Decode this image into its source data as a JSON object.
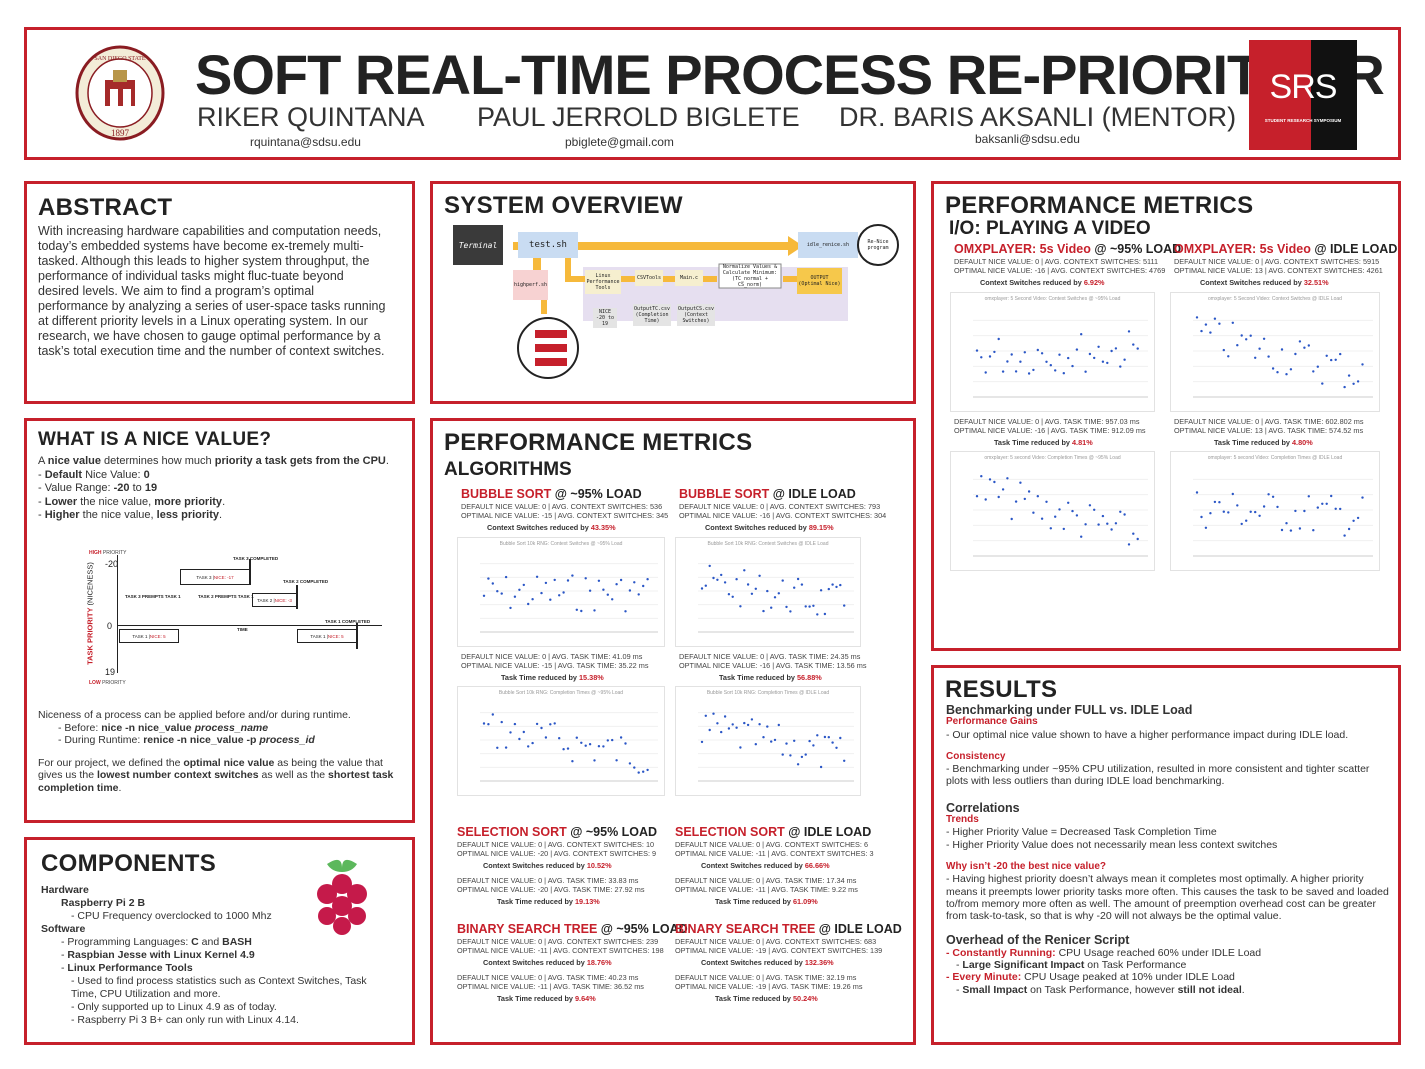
{
  "header": {
    "title": "SOFT REAL-TIME PROCESS RE-PRIORITIZER",
    "authors": [
      {
        "name": "RIKER QUINTANA",
        "email": "rquintana@sdsu.edu"
      },
      {
        "name": "PAUL JERROLD BIGLETE",
        "email": "pbiglete@gmail.com"
      },
      {
        "name": "DR. BARIS AKSANLI (MENTOR)",
        "email": "baksanli@sdsu.edu"
      }
    ],
    "seal_text": "SAN DIEGO STATE UNIVERSITY",
    "seal_year": "1897",
    "srs_logo": "SRS",
    "srs_sub": "STUDENT RESEARCH SYMPOSIUM"
  },
  "abstract": {
    "heading": "ABSTRACT",
    "body": "With increasing hardware capabilities and computation needs, today’s embedded systems have become ex-tremely multi-tasked. Although this leads to higher system throughput, the performance of individual tasks might fluc-tuate beyond desired levels. We aim to find a program’s optimal performance by analyzing a series of user-space tasks running at different priority levels in a Linux operating system. In our research, we have chosen to gauge optimal performance by a task’s total execution time and the number of context switches."
  },
  "nice": {
    "heading": "WHAT IS A NICE VALUE?",
    "l1a": "A ",
    "l1b": "nice value",
    "l1c": " determines how much ",
    "l1d": "priority a task gets from the CPU",
    "l1e": ".",
    "l2a": "- ",
    "l2b": "Default",
    "l2c": " Nice Value: ",
    "l2d": "0",
    "l3a": "- Value Range: ",
    "l3b": "-20",
    "l3c": " to ",
    "l3d": "19",
    "l4a": "- ",
    "l4b": "Lower",
    "l4c": " the nice value, ",
    "l4d": "more priority",
    "l4e": ".",
    "l5a": "- ",
    "l5b": "Higher",
    "l5c": " the nice value, ",
    "l5d": "less priority",
    "l5e": ".",
    "diagram": {
      "high": "HIGH",
      "high2": "PRIORITY",
      "low": "LOW",
      "low2": "PRIORITY",
      "axis": "TASK PRIORITY",
      "axis2": "(NICENESS)",
      "y_top": "-20",
      "y_mid": "0",
      "y_bot": "19",
      "time": "TIME",
      "t3a": "TASK 3 | ",
      "t3b": "NICE: -17",
      "t3done": "TASK 3 COMPLETED",
      "t2a": "TASK 2 | ",
      "t2b": "NICE: -3",
      "t2done": "TASK 2 COMPLETED",
      "t1a": "TASK 1 | ",
      "t1b": "NICE: 5",
      "t1done": "TASK 1 COMPLETED",
      "p31": "TASK 3 PREMPTS TASK 1",
      "p21": "TASK 2 PREMPTS TASK 1"
    },
    "r1": "Niceness of a process can be applied before and/or during runtime.",
    "r2a": "- Before: ",
    "r2b": "nice -n nice_value ",
    "r2c": "process_name",
    "r3a": "- During Runtime: ",
    "r3b": "renice -n nice_value -p ",
    "r3c": "process_id",
    "r4a": "For our project, we defined the ",
    "r4b": "optimal nice value",
    "r4c": " as being the value that gives us the ",
    "r4d": "lowest number context switches",
    "r4e": " as well as the ",
    "r4f": "shortest task completion time",
    "r4g": "."
  },
  "components": {
    "heading": "COMPONENTS",
    "hw": "Hardware",
    "pi": "Raspberry Pi 2 B",
    "cpu": "- CPU Frequency overclocked to 1000 Mhz",
    "sw": "Software",
    "lang_a": "- Programming Languages: ",
    "lang_b": "C",
    "lang_c": " and ",
    "lang_d": "BASH",
    "os_a": "- ",
    "os_b": "Raspbian Jesse with  Linux Kernel 4.9",
    "lpt_a": "- ",
    "lpt_b": "Linux Performance Tools",
    "lpt1": "- Used to find process statistics such as Context Switches, Task Time, CPU Utilization and more.",
    "lpt2": "- Only supported up to Linux 4.9 as of today.",
    "lpt3": "- Raspberry Pi 3 B+ can only run with Linux 4.14."
  },
  "overview": {
    "heading": "SYSTEM OVERVIEW",
    "terminal": "Terminal",
    "test": "test.sh",
    "idle": "idle_renice.sh",
    "renice": "Re-Nice program",
    "highperf": "highperf.sh",
    "lpt": "Linux Performance Tools",
    "csv": "CSVTools",
    "main": "Main.c",
    "norm": "Normalize Values & Calculate Minimum:(TC_normal + CS_norm)",
    "output": "OUTPUT (Optimal Nice)",
    "nice": "NICE -20 to 19",
    "out1": "OutputTC.csv (Completion Time)",
    "out2": "OutputCS.csv (Context Switches)"
  },
  "algorithms": {
    "heading": "PERFORMANCE METRICS",
    "sub": "ALGORITHMS",
    "items": [
      {
        "name": "BUBBLE SORT",
        "load": " @ ~95% LOAD",
        "cs1": "DEFAULT NICE VALUE: 0 | AVG. CONTEXT SWITCHES: 536",
        "cs2": "OPTIMAL NICE VALUE: -15 | AVG. CONTEXT SWITCHES: 345",
        "csr_label": "Context Switches reduced by ",
        "csr": "43.35%",
        "tt1": "DEFAULT NICE VALUE: 0 | AVG. TASK TIME: 41.09 ms",
        "tt2": "OPTIMAL NICE VALUE: -15 | AVG. TASK TIME: 35.22 ms",
        "ttr_label": "Task Time reduced by ",
        "ttr": "15.38%",
        "chart1": "Bubble Sort 10k RNG: Context Switches @ ~95% Load",
        "chart2": "Bubble Sort 10k RNG: Completion Times @ ~95% Load"
      },
      {
        "name": "BUBBLE SORT",
        "load": " @ IDLE LOAD",
        "cs1": "DEFAULT NICE VALUE: 0 | AVG. CONTEXT SWITCHES: 793",
        "cs2": "OPTIMAL NICE VALUE: -16 | AVG. CONTEXT SWITCHES: 304",
        "csr_label": "Context Switches reduced by ",
        "csr": "89.15%",
        "tt1": "DEFAULT NICE VALUE: 0 | AVG. TASK TIME: 24.35 ms",
        "tt2": "OPTIMAL NICE VALUE: -16 | AVG. TASK TIME: 13.56 ms",
        "ttr_label": "Task Time reduced by ",
        "ttr": "56.88%",
        "chart1": "Bubble Sort 10k RNG: Context Switches @ IDLE Load",
        "chart2": "Bubble Sort 10k RNG: Completion Times @ IDLE Load"
      },
      {
        "name": "SELECTION SORT",
        "load": " @ ~95% LOAD",
        "cs1": "DEFAULT NICE VALUE: 0 | AVG. CONTEXT SWITCHES: 10",
        "cs2": "OPTIMAL NICE VALUE: -20 | AVG. CONTEXT SWITCHES: 9",
        "csr_label": "Context Switches reduced by ",
        "csr": "10.52%",
        "tt1": "DEFAULT NICE VALUE: 0 | AVG. TASK TIME: 33.83 ms",
        "tt2": "OPTIMAL NICE VALUE: -20 | AVG. TASK TIME: 27.92 ms",
        "ttr_label": "Task Time reduced by ",
        "ttr": "19.13%"
      },
      {
        "name": "SELECTION SORT",
        "load": " @ IDLE LOAD",
        "cs1": "DEFAULT NICE VALUE: 0 | AVG. CONTEXT SWITCHES: 6",
        "cs2": "OPTIMAL NICE VALUE: -11 | AVG. CONTEXT SWITCHES: 3",
        "csr_label": "Context Switches reduced by ",
        "csr": "66.66%",
        "tt1": "DEFAULT NICE VALUE: 0 | AVG. TASK TIME: 17.34 ms",
        "tt2": "OPTIMAL NICE VALUE: -11 | AVG. TASK TIME: 9.22 ms",
        "ttr_label": "Task Time reduced by ",
        "ttr": "61.09%"
      },
      {
        "name": "BINARY SEARCH TREE",
        "load": " @ ~95% LOAD",
        "cs1": "DEFAULT NICE VALUE: 0 | AVG. CONTEXT SWITCHES: 239",
        "cs2": "OPTIMAL NICE VALUE: -11 | AVG. CONTEXT SWITCHES: 198",
        "csr_label": "Context Switches reduced by ",
        "csr": "18.76%",
        "tt1": "DEFAULT NICE VALUE: 0 | AVG. TASK TIME: 40.23 ms",
        "tt2": "OPTIMAL NICE VALUE: -11 | AVG. TASK TIME: 36.52 ms",
        "ttr_label": "Task Time reduced by ",
        "ttr": "9.64%"
      },
      {
        "name": "BINARY SEARCH TREE",
        "load": " @ IDLE LOAD",
        "cs1": "DEFAULT NICE VALUE: 0 | AVG. CONTEXT SWITCHES: 683",
        "cs2": "OPTIMAL NICE VALUE: -19 | AVG. CONTEXT SWITCHES: 139",
        "csr_label": "Context Switches reduced by ",
        "csr": "132.36%",
        "tt1": "DEFAULT NICE VALUE: 0 | AVG. TASK TIME: 32.19 ms",
        "tt2": "OPTIMAL NICE VALUE: -19 | AVG. TASK TIME: 19.26 ms",
        "ttr_label": "Task Time reduced by ",
        "ttr": "50.24%"
      }
    ]
  },
  "io": {
    "heading": "PERFORMANCE METRICS",
    "sub": "I/O: PLAYING A VIDEO",
    "items": [
      {
        "name": "OMXPLAYER: 5s Video",
        "load": " @ ~95% LOAD",
        "cs1": "DEFAULT NICE VALUE: 0 | AVG. CONTEXT SWITCHES: 5111",
        "cs2": "OPTIMAL NICE VALUE: -16 | AVG. CONTEXT SWITCHES: 4769",
        "csr_label": "Context Switches reduced by ",
        "csr": "6.92%",
        "tt1": "DEFAULT NICE VALUE: 0 | AVG. TASK TIME: 957.03 ms",
        "tt2": "OPTIMAL NICE VALUE: -16 | AVG. TASK TIME: 912.09 ms",
        "ttr_label": "Task Time reduced by ",
        "ttr": "4.81%",
        "chart1": "omxplayer: 5 Second Video: Context Switches @ ~95% Load",
        "chart2": "omxplayer: 5 second Video: Completion Times @ ~95% Load"
      },
      {
        "name": "OMXPLAYER: 5s Video",
        "load": " @ IDLE LOAD",
        "cs1": "DEFAULT NICE VALUE: 0 | AVG. CONTEXT SWITCHES: 5915",
        "cs2": "OPTIMAL NICE VALUE: 13 | AVG. CONTEXT SWITCHES: 4261",
        "csr_label": "Context Switches reduced by ",
        "csr": "32.51%",
        "tt1": "DEFAULT NICE VALUE: 0 | AVG. TASK TIME: 602.802 ms",
        "tt2": "OPTIMAL NICE VALUE: 13 | AVG. TASK TIME: 574.52 ms",
        "ttr_label": "Task Time reduced by ",
        "ttr": "4.80%",
        "chart1": "omxplayer: 5 Second Video: Context Switches @ IDLE Load",
        "chart2": "omxplayer: 5 second Video: Completion Times @ IDLE Load"
      }
    ]
  },
  "results": {
    "heading": "RESULTS",
    "sub1": "Benchmarking under FULL vs. IDLE Load",
    "pg": "Performance Gains",
    "pg1": "- Our optimal nice value shown to have a higher performance impact during IDLE load.",
    "cons": "Consistency",
    "cons1": "- Benchmarking under ~95% CPU utilization, resulted in more consistent and tighter scatter plots with less outliers than during IDLE load benchmarking.",
    "corr": "Correlations",
    "trends": "Trends",
    "tr1": "- Higher Priority Value = Decreased Task Completion Time",
    "tr2": "- Higher Priority Value does not necessarily mean less context switches",
    "why": "Why isn’t -20 the best nice value?",
    "why1": "- Having highest priority doesn’t always mean it completes most optimally. A higher priority means it preempts lower priority tasks more often. This causes the task to be saved and loaded to/from memory more often as well. The amount of preemption overhead cost can be greater from task-to-task, so that is why -20 will not always be the optimal value.",
    "ov": "Overhead of the Renicer Script",
    "cr_a": "- Constantly Running:",
    "cr_b": " CPU Usage reached 60% under IDLE Load",
    "cr2_a": "- ",
    "cr2_b": "Large Significant Impact",
    "cr2_c": " on Task Performance",
    "em_a": "- Every Minute:",
    "em_b": " CPU Usage peaked at 10% under IDLE Load",
    "em2_a": "- ",
    "em2_b": "Small Impact",
    "em2_c": " on Task Performance, however ",
    "em2_d": "still not ideal",
    "em2_e": "."
  }
}
